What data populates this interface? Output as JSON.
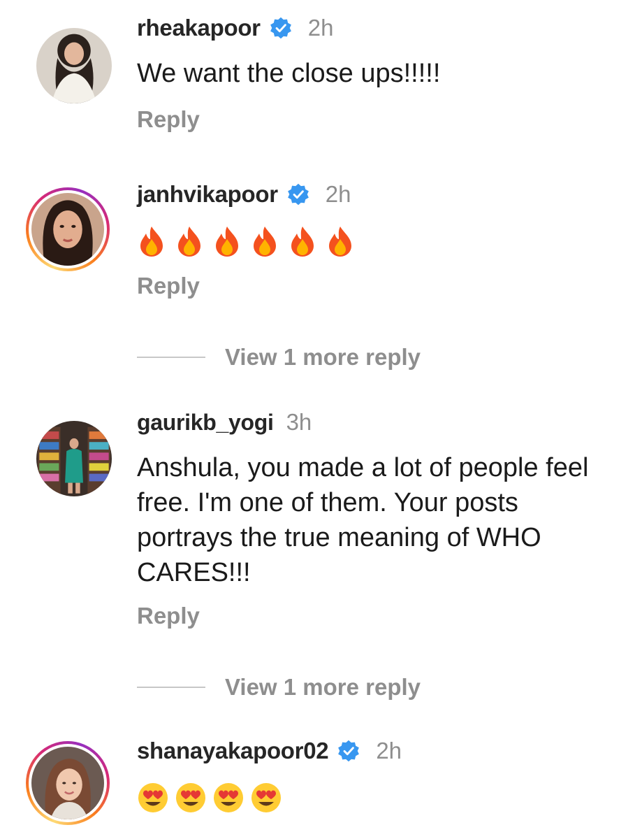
{
  "comments": [
    {
      "username": "rheakapoor",
      "verified": true,
      "time": "2h",
      "text": "We want the close ups!!!!!",
      "reply_label": "Reply",
      "avatar_icon": "portrait-avatar"
    },
    {
      "username": "janhvikapoor",
      "verified": true,
      "time": "2h",
      "emoji": [
        "fire",
        "fire",
        "fire",
        "fire",
        "fire",
        "fire"
      ],
      "reply_label": "Reply",
      "view_more": "View 1 more reply",
      "avatar_icon": "portrait-avatar"
    },
    {
      "username": "gaurikb_yogi",
      "verified": false,
      "time": "3h",
      "text": "Anshula, you made a lot of people feel free. I'm one of them. Your posts portrays the true meaning of WHO CARES!!!",
      "reply_label": "Reply",
      "view_more": "View 1 more reply",
      "avatar_icon": "bookstore-avatar"
    },
    {
      "username": "shanayakapoor02",
      "verified": true,
      "time": "2h",
      "emoji": [
        "heart-eyes",
        "heart-eyes",
        "heart-eyes",
        "heart-eyes"
      ],
      "avatar_icon": "portrait-avatar"
    }
  ],
  "colors": {
    "verified_blue": "#3897f0",
    "muted_text": "#8e8e8e",
    "story_ring": [
      "#feda75",
      "#fa7e1e",
      "#d62976",
      "#962fbf"
    ]
  }
}
